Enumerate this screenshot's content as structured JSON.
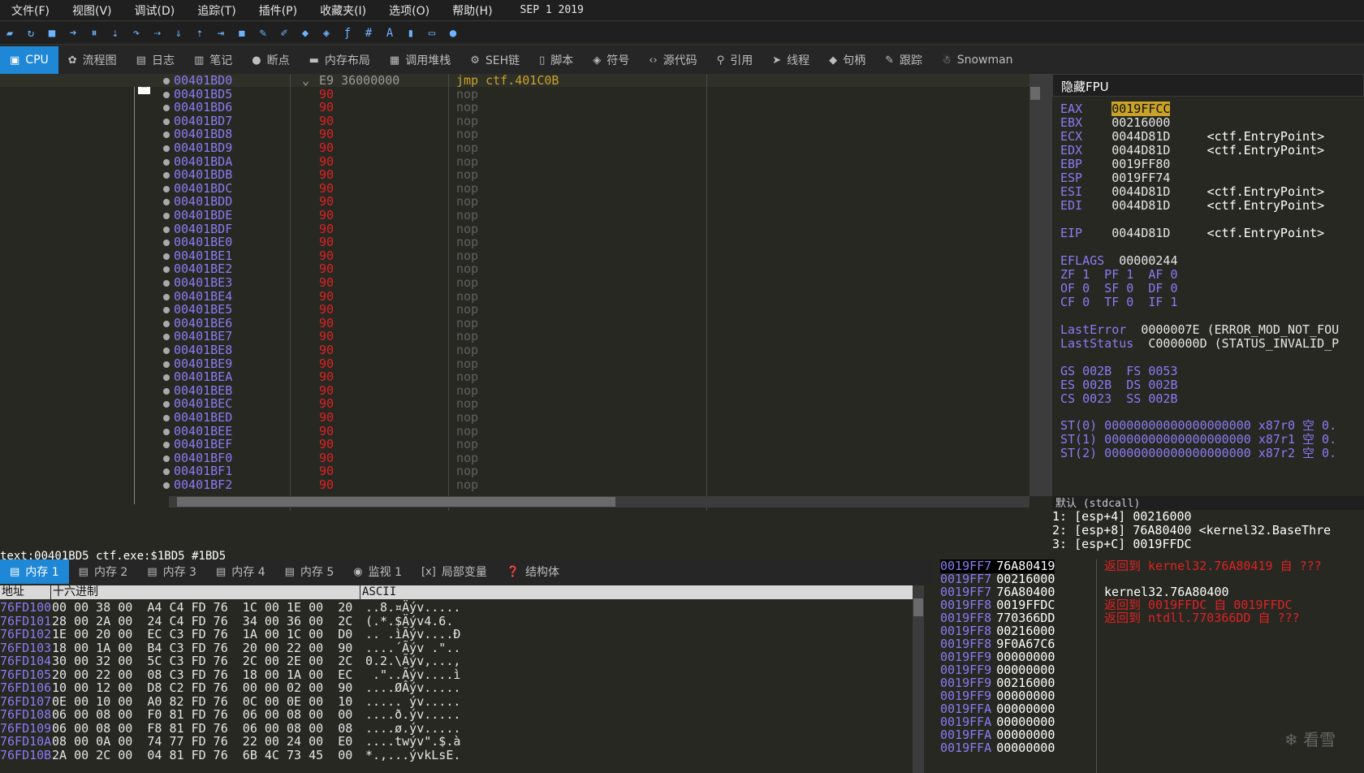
{
  "menu": {
    "items": [
      "文件(F)",
      "视图(V)",
      "调试(D)",
      "追踪(T)",
      "插件(P)",
      "收藏夹(I)",
      "选项(O)",
      "帮助(H)"
    ],
    "date": "SEP 1 2019"
  },
  "toolbar": {
    "icons": [
      "open-icon",
      "restart-icon",
      "close-icon",
      "run-icon",
      "pause-icon",
      "step-into-icon",
      "step-over-icon",
      "trace-into-icon",
      "trace-over-icon",
      "run-to-user-icon",
      "run-to-selection-icon",
      "scylla-icon",
      "edit-icon",
      "comment-icon",
      "label-icon",
      "bookmark-icon",
      "function-icon",
      "hash-icon",
      "font-icon",
      "template-icon",
      "calc-icon",
      "globe-icon"
    ]
  },
  "tabs": [
    {
      "label": "CPU",
      "icon": "cpu-icon",
      "active": true
    },
    {
      "label": "流程图",
      "icon": "graph-icon"
    },
    {
      "label": "日志",
      "icon": "log-icon"
    },
    {
      "label": "笔记",
      "icon": "notes-icon"
    },
    {
      "label": "断点",
      "icon": "breakpoint-icon"
    },
    {
      "label": "内存布局",
      "icon": "memory-map-icon"
    },
    {
      "label": "调用堆栈",
      "icon": "callstack-icon"
    },
    {
      "label": "SEH链",
      "icon": "seh-icon"
    },
    {
      "label": "脚本",
      "icon": "script-icon"
    },
    {
      "label": "符号",
      "icon": "symbol-icon"
    },
    {
      "label": "源代码",
      "icon": "source-icon"
    },
    {
      "label": "引用",
      "icon": "references-icon"
    },
    {
      "label": "线程",
      "icon": "threads-icon"
    },
    {
      "label": "句柄",
      "icon": "handles-icon"
    },
    {
      "label": "跟踪",
      "icon": "trace-icon"
    },
    {
      "label": "Snowman",
      "icon": "snowman-icon"
    }
  ],
  "disasm": {
    "first": {
      "addr": "00401BD0",
      "bytes": "E9 36000000",
      "instr": "jmp ctf.401C0B"
    },
    "rows": [
      "00401BD5",
      "00401BD6",
      "00401BD7",
      "00401BD8",
      "00401BD9",
      "00401BDA",
      "00401BDB",
      "00401BDC",
      "00401BDD",
      "00401BDE",
      "00401BDF",
      "00401BE0",
      "00401BE1",
      "00401BE2",
      "00401BE3",
      "00401BE4",
      "00401BE5",
      "00401BE6",
      "00401BE7",
      "00401BE8",
      "00401BE9",
      "00401BEA",
      "00401BEB",
      "00401BEC",
      "00401BED",
      "00401BEE",
      "00401BEF",
      "00401BF0",
      "00401BF1",
      "00401BF2"
    ],
    "nop_bytes": "90",
    "nop_instr": "nop"
  },
  "regs": {
    "header": "隐藏FPU",
    "lines": [
      [
        "EAX",
        "0019FFCC",
        ""
      ],
      [
        "EBX",
        "00216000",
        ""
      ],
      [
        "ECX",
        "0044D81D",
        "<ctf.EntryPoint>"
      ],
      [
        "EDX",
        "0044D81D",
        "<ctf.EntryPoint>"
      ],
      [
        "EBP",
        "0019FF80",
        ""
      ],
      [
        "ESP",
        "0019FF74",
        ""
      ],
      [
        "ESI",
        "0044D81D",
        "<ctf.EntryPoint>"
      ],
      [
        "EDI",
        "0044D81D",
        "<ctf.EntryPoint>"
      ],
      [
        "EIP",
        "0044D81D",
        "<ctf.EntryPoint>"
      ],
      [
        "EFLAGS",
        "00000244",
        ""
      ],
      [
        "ZF 1  PF 1  AF 0",
        "",
        ""
      ],
      [
        "OF 0  SF 0  DF 0",
        "",
        ""
      ],
      [
        "CF 0  TF 0  IF 1",
        "",
        ""
      ],
      [
        "LastError",
        "0000007E (ERROR_MOD_NOT_FOU",
        ""
      ],
      [
        "LastStatus",
        "C000000D (STATUS_INVALID_P",
        ""
      ],
      [
        "GS 002B  FS 0053",
        "",
        ""
      ],
      [
        "ES 002B  DS 002B",
        "",
        ""
      ],
      [
        "CS 0023  SS 002B",
        "",
        ""
      ],
      [
        "ST(0) 00000000000000000000 x87r0 空 0.",
        "",
        ""
      ],
      [
        "ST(1) 00000000000000000000 x87r1 空 0.",
        "",
        ""
      ],
      [
        "ST(2) 00000000000000000000 x87r2 空 0.",
        "",
        ""
      ]
    ]
  },
  "callconv": {
    "label": "默认 (stdcall)",
    "lines": [
      "1: [esp+4] 00216000",
      "2: [esp+8] 76A80400 <kernel32.BaseThre",
      "3: [esp+C] 0019FFDC"
    ]
  },
  "status": {
    "text": "text:00401BD5 ctf.exe:$1BD5 #1BD5"
  },
  "memtabs": [
    {
      "label": "内存 1",
      "icon": "memory-icon",
      "active": true
    },
    {
      "label": "内存 2",
      "icon": "memory-icon"
    },
    {
      "label": "内存 3",
      "icon": "memory-icon"
    },
    {
      "label": "内存 4",
      "icon": "memory-icon"
    },
    {
      "label": "内存 5",
      "icon": "memory-icon"
    },
    {
      "label": "监视 1",
      "icon": "watch-icon"
    },
    {
      "label": "局部变量",
      "icon": "locals-icon"
    },
    {
      "label": "结构体",
      "icon": "struct-icon"
    }
  ],
  "dump": {
    "headers": [
      "地址",
      "十六进制",
      "ASCII"
    ],
    "rows": [
      {
        "a": "76FD100",
        "h": "00 00 38 00  A4 C4 FD 76  1C 00 1E 00  20",
        "c": "..8.¤Äýv....."
      },
      {
        "a": "76FD101",
        "h": "28 00 2A 00  24 C4 FD 76  34 00 36 00  2C",
        "c": "(.*.$Äýv4.6."
      },
      {
        "a": "76FD102",
        "h": "1E 00 20 00  EC C3 FD 76  1A 00 1C 00  D0",
        "c": ".. .ìÃýv....Ð"
      },
      {
        "a": "76FD103",
        "h": "18 00 1A 00  B4 C3 FD 76  20 00 22 00  90",
        "c": "....´Ãýv .\".."
      },
      {
        "a": "76FD104",
        "h": "30 00 32 00  5C C3 FD 76  2C 00 2E 00  2C",
        "c": "0.2.\\Ãýv,...,"
      },
      {
        "a": "76FD105",
        "h": "20 00 22 00  08 C3 FD 76  18 00 1A 00  EC",
        "c": " .\"..Ãýv....ì"
      },
      {
        "a": "76FD106",
        "h": "10 00 12 00  D8 C2 FD 76  00 00 02 00  90",
        "c": "....ØÂýv....."
      },
      {
        "a": "76FD107",
        "h": "0E 00 10 00  A0 82 FD 76  0C 00 0E 00  10",
        "c": "..... ýv....."
      },
      {
        "a": "76FD108",
        "h": "06 00 08 00  F0 81 FD 76  06 00 08 00  00",
        "c": "....ð.ýv....."
      },
      {
        "a": "76FD109",
        "h": "06 00 08 00  F8 81 FD 76  06 00 08 00  08",
        "c": "....ø.ýv....."
      },
      {
        "a": "76FD10A",
        "h": "08 00 0A 00  74 77 FD 76  22 00 24 00  E0",
        "c": "....twýv\".$.à"
      },
      {
        "a": "76FD10B",
        "h": "2A 00 2C 00  04 81 FD 76  6B 4C 73 45  00",
        "c": "*.,...ývkLsE."
      }
    ]
  },
  "stack": {
    "rows": [
      {
        "a": "0019FF7",
        "v": "76A80419"
      },
      {
        "a": "0019FF7",
        "v": "00216000"
      },
      {
        "a": "0019FF7",
        "v": "76A80400"
      },
      {
        "a": "0019FF8",
        "v": "0019FFDC"
      },
      {
        "a": "0019FF8",
        "v": "770366DD"
      },
      {
        "a": "0019FF8",
        "v": "00216000"
      },
      {
        "a": "0019FF8",
        "v": "9F0A67C6"
      },
      {
        "a": "0019FF9",
        "v": "00000000"
      },
      {
        "a": "0019FF9",
        "v": "00000000"
      },
      {
        "a": "0019FF9",
        "v": "00216000"
      },
      {
        "a": "0019FF9",
        "v": "00000000"
      },
      {
        "a": "0019FFA",
        "v": "00000000"
      },
      {
        "a": "0019FFA",
        "v": "00000000"
      },
      {
        "a": "0019FFA",
        "v": "00000000"
      },
      {
        "a": "0019FFA",
        "v": "00000000"
      }
    ],
    "comments": [
      {
        "row": 0,
        "text": "返回到 kernel32.76A80419 自 ???",
        "color": "#e02222"
      },
      {
        "row": 2,
        "text": "kernel32.76A80400",
        "color": "#ffffff"
      },
      {
        "row": 3,
        "text": "返回到 0019FFDC 自 0019FFDC",
        "color": "#e02222"
      },
      {
        "row": 4,
        "text": "返回到 ntdll.770366DD 自 ???",
        "color": "#e02222"
      }
    ]
  },
  "watermark": "看雪"
}
